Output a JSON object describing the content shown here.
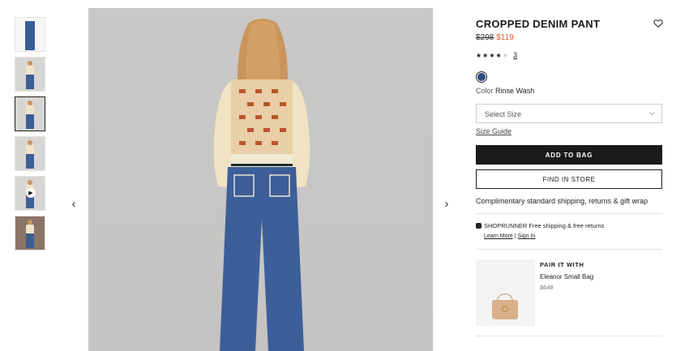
{
  "gallery": {
    "thumbnails": [
      "thumb-front",
      "thumb-model-1",
      "thumb-model-2",
      "thumb-model-3",
      "thumb-video",
      "thumb-lifestyle"
    ],
    "active_index": 2,
    "prev_icon": "chevron-left-icon",
    "next_icon": "chevron-right-icon"
  },
  "product": {
    "title": "CROPPED DENIM PANT",
    "original_price": "$298",
    "sale_price": "$119",
    "rating_stars": 3.5,
    "review_count": "3",
    "color_label": "Color",
    "color_value": "Rinse Wash",
    "swatch_color": "#2f4a7a",
    "size_placeholder": "Select Size",
    "size_guide": "Size Guide",
    "add_to_bag": "ADD TO BAG",
    "find_in_store": "FIND IN STORE",
    "shipping_note": "Complimentary standard shipping, returns & gift wrap"
  },
  "shoprunner": {
    "text": "SHOPRUNNER Free shipping & free returns",
    "learn_more": "Learn More",
    "separator": "|",
    "sign_in": "Sign In"
  },
  "pair": {
    "label": "PAIR IT WITH",
    "name": "Eleanor Small Bag",
    "price": "$648"
  },
  "colors": {
    "sale": "#e05b2a",
    "button": "#1b1b1b"
  }
}
